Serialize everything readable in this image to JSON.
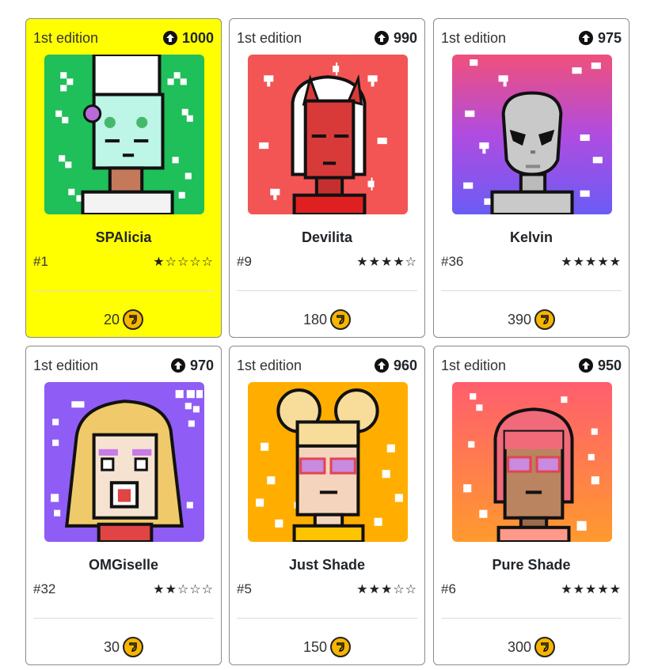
{
  "cards": [
    {
      "edition": "1st edition",
      "votes": "1000",
      "name": "SPAlicia",
      "rank": "#1",
      "stars": "★☆☆☆☆",
      "price": "20",
      "bg": "#1fbf5a",
      "highlight": true
    },
    {
      "edition": "1st edition",
      "votes": "990",
      "name": "Devilita",
      "rank": "#9",
      "stars": "★★★★☆",
      "price": "180",
      "bg": "#f35454",
      "highlight": false
    },
    {
      "edition": "1st edition",
      "votes": "975",
      "name": "Kelvin",
      "rank": "#36",
      "stars": "★★★★★",
      "price": "390",
      "bg": "#c04de0",
      "highlight": false
    },
    {
      "edition": "1st edition",
      "votes": "970",
      "name": "OMGiselle",
      "rank": "#32",
      "stars": "★★☆☆☆",
      "price": "30",
      "bg": "#8f5cf5",
      "highlight": false
    },
    {
      "edition": "1st edition",
      "votes": "960",
      "name": "Just Shade",
      "rank": "#5",
      "stars": "★★★☆☆",
      "price": "150",
      "bg": "#ffae00",
      "highlight": false
    },
    {
      "edition": "1st edition",
      "votes": "950",
      "name": "Pure Shade",
      "rank": "#6",
      "stars": "★★★★★",
      "price": "300",
      "bg": "#ff7a52",
      "highlight": false
    }
  ],
  "icons": {
    "vote": "upvote-circle-icon",
    "coin": "coin-icon"
  },
  "colors": {
    "highlight": "#ffff00",
    "coin": "#f7b500"
  }
}
